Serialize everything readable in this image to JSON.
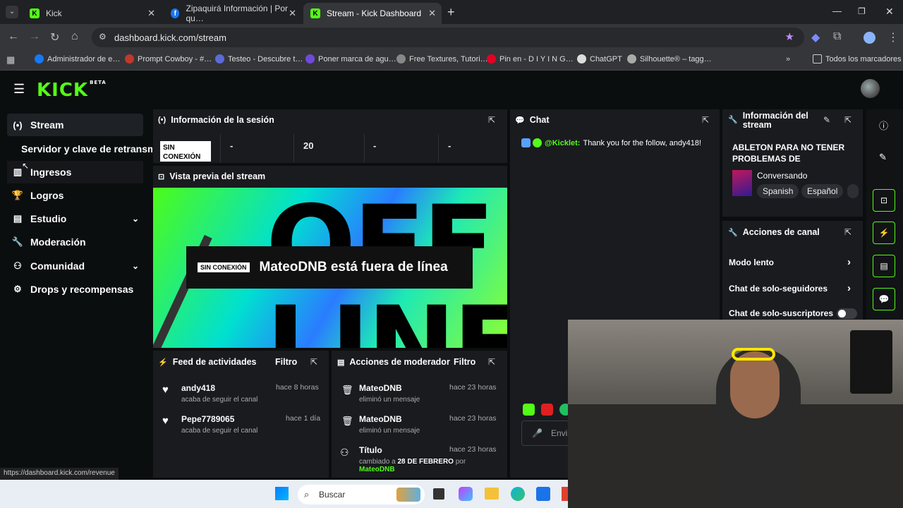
{
  "browser": {
    "tabs": [
      {
        "label": "Kick",
        "active": false
      },
      {
        "label": "Zipaquirá Información | Por qu…",
        "active": false
      },
      {
        "label": "Stream - Kick Dashboard",
        "active": true
      }
    ],
    "address": "dashboard.kick.com/stream",
    "bookmarks": [
      "Administrador de e…",
      "Prompt Cowboy - #…",
      "Testeo - Descubre t…",
      "Poner marca de agu…",
      "Free Textures, Tutori…",
      "Pin en - D I Y I N G…",
      "ChatGPT",
      "Silhouette® – tagg…"
    ],
    "all_bookmarks": "Todos los marcadores",
    "status_url": "https://dashboard.kick.com/revenue"
  },
  "kick": {
    "logo": "KICK",
    "logo_tag": "BETA",
    "accent": "#53fc18"
  },
  "sidebar": {
    "items": [
      {
        "label": "Stream",
        "icon": "broadcast-icon",
        "active": true
      },
      {
        "label": "Servidor y clave de retransm",
        "icon": "",
        "active": false
      },
      {
        "label": "Ingresos",
        "icon": "chart-icon",
        "active": false
      },
      {
        "label": "Logros",
        "icon": "trophy-icon",
        "active": false
      },
      {
        "label": "Estudio",
        "icon": "studio-icon",
        "active": false
      },
      {
        "label": "Moderación",
        "icon": "wrench-icon",
        "active": false
      },
      {
        "label": "Comunidad",
        "icon": "community-icon",
        "active": false
      },
      {
        "label": "Drops y recompensas",
        "icon": "drops-icon",
        "active": false
      }
    ]
  },
  "session": {
    "title": "Información de la sesión",
    "badge": "SIN CONEXIÓN",
    "stats": [
      "-",
      "20",
      "-",
      "-"
    ]
  },
  "preview": {
    "title": "Vista previa del stream",
    "offline_badge": "SIN CONEXIÓN",
    "offline_text": "MateoDNB está fuera de línea"
  },
  "activity": {
    "title": "Feed de actividades",
    "filter": "Filtro",
    "items": [
      {
        "name": "andy418",
        "desc": "acaba de seguir el canal",
        "time": "hace 8 horas"
      },
      {
        "name": "Pepe7789065",
        "desc": "acaba de seguir el canal",
        "time": "hace 1 día"
      }
    ]
  },
  "modactions": {
    "title": "Acciones de moderador",
    "filter": "Filtro",
    "items": [
      {
        "name": "MateoDNB",
        "desc": "eliminó un mensaje",
        "time": "hace 23 horas"
      },
      {
        "name": "MateoDNB",
        "desc": "eliminó un mensaje",
        "time": "hace 23 horas"
      },
      {
        "name": "Título",
        "desc_pre": "cambiado a ",
        "desc_bold": "28 DE FEBRERO",
        "desc_post": " por",
        "by": "MateoDNB",
        "time": "hace 23 horas"
      }
    ]
  },
  "chat": {
    "title": "Chat",
    "message_user": "@Kicklet:",
    "message_text": "Thank you for the follow, andy418!",
    "input_placeholder": "Envi"
  },
  "stream_info": {
    "title": "Información del stream",
    "stream_title": "ABLETON PARA NO TENER PROBLEMAS DE DERECHOS…",
    "category": "Conversando",
    "tags": [
      "Spanish",
      "Español"
    ]
  },
  "channel_actions": {
    "title": "Acciones de canal",
    "items": [
      {
        "label": "Modo lento",
        "type": "chevron"
      },
      {
        "label": "Chat de solo-seguidores",
        "type": "chevron"
      },
      {
        "label": "Chat de solo-suscriptores",
        "type": "toggle",
        "on": false
      }
    ]
  },
  "taskbar": {
    "search_placeholder": "Buscar"
  }
}
